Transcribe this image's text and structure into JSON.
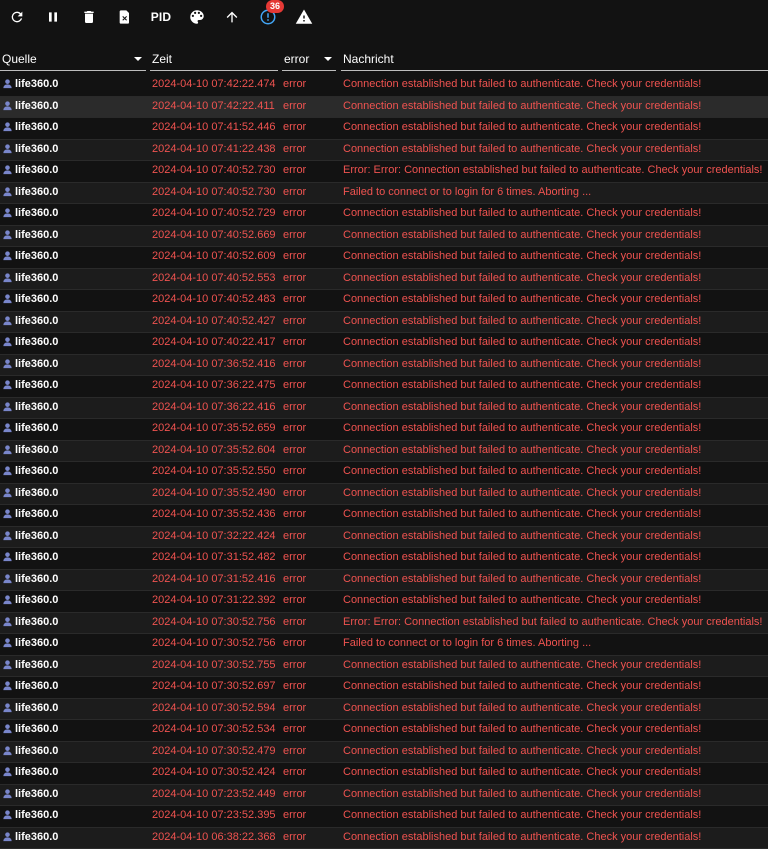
{
  "toolbar": {
    "pid_label": "PID",
    "badge_count": "36"
  },
  "columns": {
    "source": "Quelle",
    "time": "Zeit",
    "level": "error",
    "message": "Nachricht"
  },
  "rows": [
    {
      "source": "life360.0",
      "time": "2024-04-10 07:42:22.474",
      "level": "error",
      "message": "Connection established but failed to authenticate. Check your credentials!"
    },
    {
      "source": "life360.0",
      "time": "2024-04-10 07:42:22.411",
      "level": "error",
      "message": "Connection established but failed to authenticate. Check your credentials!"
    },
    {
      "source": "life360.0",
      "time": "2024-04-10 07:41:52.446",
      "level": "error",
      "message": "Connection established but failed to authenticate. Check your credentials!"
    },
    {
      "source": "life360.0",
      "time": "2024-04-10 07:41:22.438",
      "level": "error",
      "message": "Connection established but failed to authenticate. Check your credentials!"
    },
    {
      "source": "life360.0",
      "time": "2024-04-10 07:40:52.730",
      "level": "error",
      "message": "Error: Error: Connection established but failed to authenticate. Check your credentials!"
    },
    {
      "source": "life360.0",
      "time": "2024-04-10 07:40:52.730",
      "level": "error",
      "message": "Failed to connect or to login for 6 times. Aborting ..."
    },
    {
      "source": "life360.0",
      "time": "2024-04-10 07:40:52.729",
      "level": "error",
      "message": "Connection established but failed to authenticate. Check your credentials!"
    },
    {
      "source": "life360.0",
      "time": "2024-04-10 07:40:52.669",
      "level": "error",
      "message": "Connection established but failed to authenticate. Check your credentials!"
    },
    {
      "source": "life360.0",
      "time": "2024-04-10 07:40:52.609",
      "level": "error",
      "message": "Connection established but failed to authenticate. Check your credentials!"
    },
    {
      "source": "life360.0",
      "time": "2024-04-10 07:40:52.553",
      "level": "error",
      "message": "Connection established but failed to authenticate. Check your credentials!"
    },
    {
      "source": "life360.0",
      "time": "2024-04-10 07:40:52.483",
      "level": "error",
      "message": "Connection established but failed to authenticate. Check your credentials!"
    },
    {
      "source": "life360.0",
      "time": "2024-04-10 07:40:52.427",
      "level": "error",
      "message": "Connection established but failed to authenticate. Check your credentials!"
    },
    {
      "source": "life360.0",
      "time": "2024-04-10 07:40:22.417",
      "level": "error",
      "message": "Connection established but failed to authenticate. Check your credentials!"
    },
    {
      "source": "life360.0",
      "time": "2024-04-10 07:36:52.416",
      "level": "error",
      "message": "Connection established but failed to authenticate. Check your credentials!"
    },
    {
      "source": "life360.0",
      "time": "2024-04-10 07:36:22.475",
      "level": "error",
      "message": "Connection established but failed to authenticate. Check your credentials!"
    },
    {
      "source": "life360.0",
      "time": "2024-04-10 07:36:22.416",
      "level": "error",
      "message": "Connection established but failed to authenticate. Check your credentials!"
    },
    {
      "source": "life360.0",
      "time": "2024-04-10 07:35:52.659",
      "level": "error",
      "message": "Connection established but failed to authenticate. Check your credentials!"
    },
    {
      "source": "life360.0",
      "time": "2024-04-10 07:35:52.604",
      "level": "error",
      "message": "Connection established but failed to authenticate. Check your credentials!"
    },
    {
      "source": "life360.0",
      "time": "2024-04-10 07:35:52.550",
      "level": "error",
      "message": "Connection established but failed to authenticate. Check your credentials!"
    },
    {
      "source": "life360.0",
      "time": "2024-04-10 07:35:52.490",
      "level": "error",
      "message": "Connection established but failed to authenticate. Check your credentials!"
    },
    {
      "source": "life360.0",
      "time": "2024-04-10 07:35:52.436",
      "level": "error",
      "message": "Connection established but failed to authenticate. Check your credentials!"
    },
    {
      "source": "life360.0",
      "time": "2024-04-10 07:32:22.424",
      "level": "error",
      "message": "Connection established but failed to authenticate. Check your credentials!"
    },
    {
      "source": "life360.0",
      "time": "2024-04-10 07:31:52.482",
      "level": "error",
      "message": "Connection established but failed to authenticate. Check your credentials!"
    },
    {
      "source": "life360.0",
      "time": "2024-04-10 07:31:52.416",
      "level": "error",
      "message": "Connection established but failed to authenticate. Check your credentials!"
    },
    {
      "source": "life360.0",
      "time": "2024-04-10 07:31:22.392",
      "level": "error",
      "message": "Connection established but failed to authenticate. Check your credentials!"
    },
    {
      "source": "life360.0",
      "time": "2024-04-10 07:30:52.756",
      "level": "error",
      "message": "Error: Error: Connection established but failed to authenticate. Check your credentials!"
    },
    {
      "source": "life360.0",
      "time": "2024-04-10 07:30:52.756",
      "level": "error",
      "message": "Failed to connect or to login for 6 times. Aborting ..."
    },
    {
      "source": "life360.0",
      "time": "2024-04-10 07:30:52.755",
      "level": "error",
      "message": "Connection established but failed to authenticate. Check your credentials!"
    },
    {
      "source": "life360.0",
      "time": "2024-04-10 07:30:52.697",
      "level": "error",
      "message": "Connection established but failed to authenticate. Check your credentials!"
    },
    {
      "source": "life360.0",
      "time": "2024-04-10 07:30:52.594",
      "level": "error",
      "message": "Connection established but failed to authenticate. Check your credentials!"
    },
    {
      "source": "life360.0",
      "time": "2024-04-10 07:30:52.534",
      "level": "error",
      "message": "Connection established but failed to authenticate. Check your credentials!"
    },
    {
      "source": "life360.0",
      "time": "2024-04-10 07:30:52.479",
      "level": "error",
      "message": "Connection established but failed to authenticate. Check your credentials!"
    },
    {
      "source": "life360.0",
      "time": "2024-04-10 07:30:52.424",
      "level": "error",
      "message": "Connection established but failed to authenticate. Check your credentials!"
    },
    {
      "source": "life360.0",
      "time": "2024-04-10 07:23:52.449",
      "level": "error",
      "message": "Connection established but failed to authenticate. Check your credentials!"
    },
    {
      "source": "life360.0",
      "time": "2024-04-10 07:23:52.395",
      "level": "error",
      "message": "Connection established but failed to authenticate. Check your credentials!"
    },
    {
      "source": "life360.0",
      "time": "2024-04-10 06:38:22.368",
      "level": "error",
      "message": "Connection established but failed to authenticate. Check your credentials!"
    }
  ]
}
